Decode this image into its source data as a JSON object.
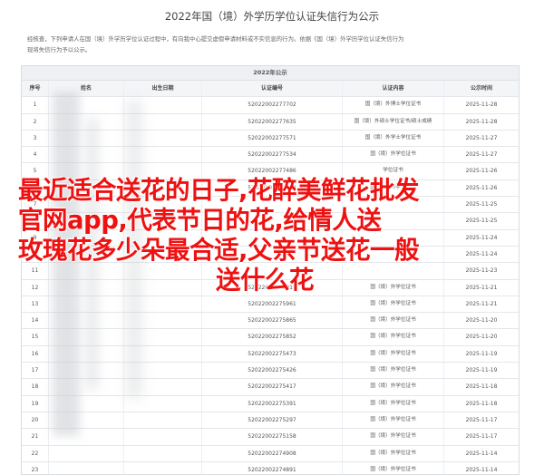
{
  "page": {
    "title": "2022年国（境）外学历学位认证失信行为公示",
    "intro_line1": "经核查，下列申请人在国（境）外学历学位认证过程中，有向我中心提交虚假申请材料或不实信息的行为。依据《国（境）外学历学位认证失信行为",
    "intro_line2": "现将失信行为予以公示。"
  },
  "table": {
    "title": "2022年公示",
    "headers": [
      "序号",
      "姓名",
      "出生日期",
      "认证编号",
      "认证内容",
      "公示时间"
    ],
    "rows": [
      {
        "no": "1",
        "cert": "52022002277702",
        "content": "国（境）外博士学位证书",
        "date": "2025-11-28"
      },
      {
        "no": "2",
        "cert": "52022002277635",
        "content": "国（境）外硕士学位证书/硕士成绩",
        "date": "2025-11-28"
      },
      {
        "no": "3",
        "cert": "52022002277571",
        "content": "国（境）外学士学位证书",
        "date": "2025-11-27"
      },
      {
        "no": "4",
        "cert": "52022002277534",
        "content": "国（境）外学位证书",
        "date": "2025-11-27"
      },
      {
        "no": "5",
        "cert": "52022002277486",
        "content": "学位证书",
        "date": "2025-11-26"
      },
      {
        "no": "6",
        "cert": "52022002277443",
        "content": "国（境）外学位证书",
        "date": "2025-11-26"
      },
      {
        "no": "7",
        "cert": "",
        "content": "",
        "date": "2025-11-25"
      },
      {
        "no": "8",
        "cert": "",
        "content": "",
        "date": "2025-11-25"
      },
      {
        "no": "9",
        "cert": "",
        "content": "",
        "date": "2025-11-24"
      },
      {
        "no": "10",
        "cert": "",
        "content": "",
        "date": "2025-11-24"
      },
      {
        "no": "11",
        "cert": "",
        "content": "",
        "date": "2025-11-23"
      },
      {
        "no": "12",
        "cert": "52022002276019",
        "content": "国（境）外学位证书",
        "date": "2025-11-21"
      },
      {
        "no": "13",
        "cert": "52022002275961",
        "content": "国（境）外学位证书",
        "date": "2025-11-21"
      },
      {
        "no": "14",
        "cert": "52022002275865",
        "content": "国（境）外学位证书",
        "date": "2025-11-20"
      },
      {
        "no": "15",
        "cert": "52022002275852",
        "content": "国（境）外学位证书",
        "date": "2025-11-20"
      },
      {
        "no": "16",
        "cert": "52022002275473",
        "content": "国（境）外学位证书",
        "date": "2025-11-19"
      },
      {
        "no": "17",
        "cert": "52022002275426",
        "content": "国（境）外学位证书",
        "date": "2025-11-19"
      },
      {
        "no": "18",
        "cert": "52022002275417",
        "content": "国（境）外学位证书",
        "date": "2025-11-18"
      },
      {
        "no": "19",
        "cert": "52022002275391",
        "content": "国（境）外学位证书",
        "date": "2025-11-18"
      },
      {
        "no": "20",
        "cert": "52022002275297",
        "content": "国（境）外学位证书",
        "date": "2025-11-17"
      },
      {
        "no": "21",
        "cert": "52022002275158",
        "content": "国（境）外学位证书",
        "date": "2025-11-17"
      },
      {
        "no": "22",
        "cert": "52022002274908",
        "content": "国（境）外学位证书",
        "date": "2025-11-14"
      },
      {
        "no": "23",
        "cert": "52022002274891",
        "content": "国（境）外学位证书",
        "date": "2025-11-14"
      },
      {
        "no": "24",
        "cert": "52022002274859",
        "content": "国（境）外学位证书",
        "date": "2025-11-13"
      }
    ]
  },
  "overlay": {
    "line1": "最近适合送花的日子,花醉美鲜花批发",
    "line2": "官网app,代表节日的花,给情人送",
    "line3": "玫瑰花多少朵最合适,父亲节送花一般",
    "line4": "送什么花",
    "color": "#ee1111"
  }
}
